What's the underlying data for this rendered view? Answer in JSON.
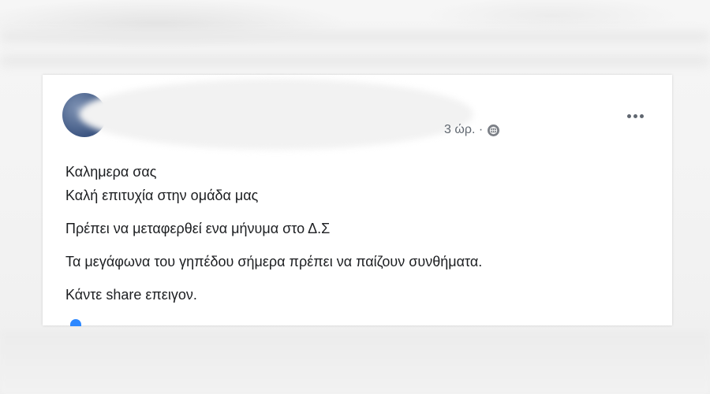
{
  "post": {
    "time": "3 ώρ. ·",
    "privacy_icon": "globe-icon",
    "menu_icon": "more-options-icon",
    "lines": [
      "Καλημερα σας",
      "Καλή επιτυχία στην ομάδα μας",
      "Πρέπει να μεταφερθεί ενα μήνυμα στο Δ.Σ",
      "Τα μεγάφωνα του γηπέδου σήμερα πρέπει  να παίζουν συνθήματα.",
      "Κάντε share επειγον."
    ]
  },
  "colors": {
    "text": "#1c1e21",
    "meta": "#606770",
    "reaction": "#2d88ff"
  }
}
